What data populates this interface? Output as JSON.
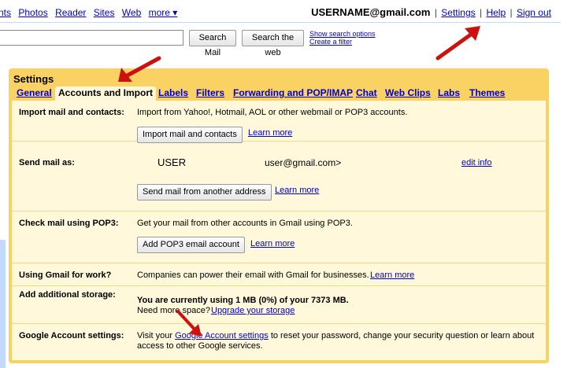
{
  "topnav": {
    "items": [
      "nts",
      "Photos",
      "Reader",
      "Sites",
      "Web",
      "more ▾"
    ]
  },
  "account": {
    "email": "USERNAME@gmail.com",
    "settings": "Settings",
    "help": "Help",
    "signout": "Sign out",
    "sep": "|"
  },
  "search": {
    "search_mail": "Search Mail",
    "search_web": "Search the web",
    "show_options": "Show search options",
    "create_filter": "Create a filter"
  },
  "settings": {
    "title": "Settings",
    "tabs": [
      "General",
      "Accounts and Import",
      "Labels",
      "Filters",
      "Forwarding and POP/IMAP",
      "Chat",
      "Web Clips",
      "Labs",
      "Themes"
    ]
  },
  "rows": {
    "import": {
      "label": "Import mail and contacts:",
      "text": "Import from Yahoo!, Hotmail, AOL or other webmail or POP3 accounts.",
      "button": "Import mail and contacts",
      "learn": "Learn more"
    },
    "sendas": {
      "label": "Send mail as:",
      "name": "USER",
      "email": "user@gmail.com>",
      "edit": "edit info",
      "button": "Send mail from another address",
      "learn": "Learn more"
    },
    "pop3": {
      "label": "Check mail using POP3:",
      "text": "Get your mail from other accounts in Gmail using POP3.",
      "button": "Add POP3 email account",
      "learn": "Learn more"
    },
    "work": {
      "label": "Using Gmail for work?",
      "text": "Companies can power their email with Gmail for businesses.",
      "learn": "Learn more"
    },
    "storage": {
      "label": "Add additional storage:",
      "usage": "You are currently using 1 MB (0%) of your 7373 MB.",
      "need": "Need more space?",
      "upgrade": "Upgrade your storage"
    },
    "google": {
      "label": "Google Account settings:",
      "pre": "Visit your",
      "link": "Google Account settings",
      "post": "to reset your password, change your security question or learn about",
      "line2": "access to other Google services."
    }
  },
  "colors": {
    "panel": "#fad163",
    "content": "#fff8da",
    "link": "#0000cc",
    "arrow": "#cc1111"
  }
}
